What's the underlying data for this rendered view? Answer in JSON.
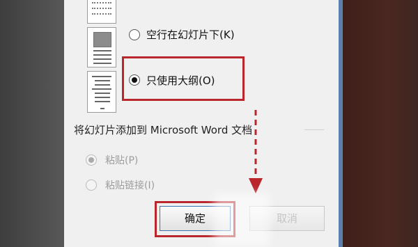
{
  "layout_option_blank_line": "空行在幻灯片下(K)",
  "layout_option_outline_only": "只使用大纲(O)",
  "section_title": "将幻灯片添加到 Microsoft Word 文档",
  "paste_option": "粘贴(P)",
  "paste_link_option": "粘贴链接(I)",
  "ok_button": "确定",
  "cancel_button": "取消",
  "colors": {
    "highlight_red": "#b9262c",
    "dialog_bg": "#f0f0f0"
  }
}
